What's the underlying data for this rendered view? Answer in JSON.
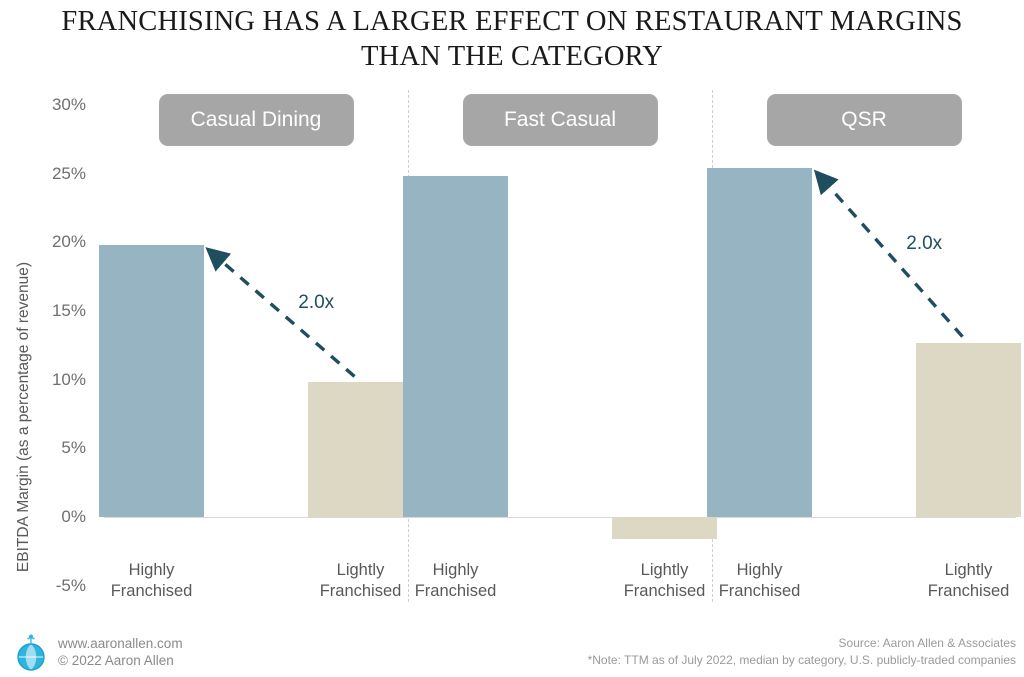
{
  "title": {
    "line1": "FRANCHISING HAS A LARGER EFFECT ON RESTAURANT MARGINS",
    "line2": "THAN THE CATEGORY"
  },
  "axis": {
    "y_title": "EBITDA Margin (as a percentage of revenue)",
    "ticks": [
      "30%",
      "25%",
      "20%",
      "15%",
      "10%",
      "5%",
      "0%",
      "-5%"
    ]
  },
  "categories": [
    {
      "label": "Casual Dining"
    },
    {
      "label": "Fast Casual"
    },
    {
      "label": "QSR"
    }
  ],
  "bars": [
    {
      "group": "Casual Dining",
      "label_line1": "Highly",
      "label_line2": "Franchised",
      "value": 19.8,
      "color": "#97b4c2",
      "series": "Highly Franchised"
    },
    {
      "group": "Casual Dining",
      "label_line1": "Lightly",
      "label_line2": "Franchised",
      "value": 9.8,
      "color": "#ddd8c3",
      "series": "Lightly Franchised"
    },
    {
      "group": "Fast Casual",
      "label_line1": "Highly",
      "label_line2": "Franchised",
      "value": 24.8,
      "color": "#97b4c2",
      "series": "Highly Franchised"
    },
    {
      "group": "Fast Casual",
      "label_line1": "Lightly",
      "label_line2": "Franchised",
      "value": -1.6,
      "color": "#ddd8c3",
      "series": "Lightly Franchised"
    },
    {
      "group": "QSR",
      "label_line1": "Highly",
      "label_line2": "Franchised",
      "value": 25.4,
      "color": "#97b4c2",
      "series": "Highly Franchised"
    },
    {
      "group": "QSR",
      "label_line1": "Lightly",
      "label_line2": "Franchised",
      "value": 12.7,
      "color": "#ddd8c3",
      "series": "Lightly Franchised"
    }
  ],
  "annotations": [
    {
      "text": "2.0x",
      "group": "Casual Dining"
    },
    {
      "text": "2.0x",
      "group": "QSR"
    }
  ],
  "footer": {
    "website": "www.aaronallen.com",
    "copyright": "© 2022 Aaron Allen",
    "source": "Source: Aaron Allen & Associates",
    "note": "*Note: TTM as of July 2022, median by category, U.S. publicly-traded companies"
  },
  "colors": {
    "blue_bar": "#97b4c2",
    "beige_bar": "#ddd8c3",
    "pill": "#a6a6a6",
    "annotation": "#1f4e5f",
    "axis_text": "#6f6f6f"
  },
  "chart_data": {
    "type": "bar",
    "title": "FRANCHISING HAS A LARGER EFFECT ON RESTAURANT MARGINS THAN THE CATEGORY",
    "xlabel": "",
    "ylabel": "EBITDA Margin (as a percentage of revenue)",
    "ylim": [
      -5,
      30
    ],
    "ytick_labels": [
      "30%",
      "25%",
      "20%",
      "15%",
      "10%",
      "5%",
      "0%",
      "-5%"
    ],
    "ytick_values": [
      30,
      25,
      20,
      15,
      10,
      5,
      0,
      -5
    ],
    "grid": false,
    "legend_position": "none",
    "categories": [
      "Casual Dining",
      "Fast Casual",
      "QSR"
    ],
    "series": [
      {
        "name": "Highly Franchised",
        "values": [
          19.8,
          24.8,
          25.4
        ],
        "color": "#97b4c2"
      },
      {
        "name": "Lightly Franchised",
        "values": [
          9.8,
          -1.6,
          12.7
        ],
        "color": "#ddd8c3"
      }
    ],
    "annotations": [
      {
        "text": "2.0x",
        "category": "Casual Dining",
        "from": "Lightly Franchised",
        "to": "Highly Franchised"
      },
      {
        "text": "2.0x",
        "category": "QSR",
        "from": "Lightly Franchised",
        "to": "Highly Franchised"
      }
    ],
    "units": "percent",
    "note": "*Note: TTM as of July 2022, median by category, U.S. publicly-traded companies",
    "source": "Source: Aaron Allen & Associates"
  }
}
